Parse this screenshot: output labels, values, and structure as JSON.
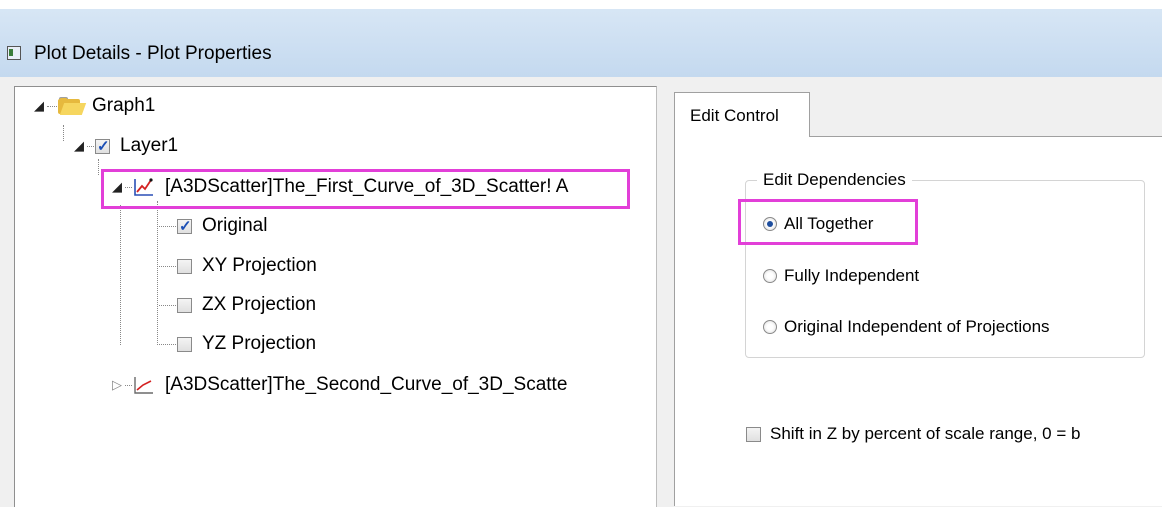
{
  "window": {
    "title": "Plot Details - Plot Properties"
  },
  "tree": {
    "graph": {
      "label": "Graph1"
    },
    "layer": {
      "label": "Layer1",
      "checked": true
    },
    "curve1": {
      "label": "[A3DScatter]The_First_Curve_of_3D_Scatter! A"
    },
    "children": [
      {
        "label": "Original",
        "checked": true
      },
      {
        "label": "XY Projection",
        "checked": false
      },
      {
        "label": "ZX Projection",
        "checked": false
      },
      {
        "label": "YZ Projection",
        "checked": false
      }
    ],
    "curve2": {
      "label": "[A3DScatter]The_Second_Curve_of_3D_Scatte"
    }
  },
  "tabs": {
    "edit_control": "Edit Control"
  },
  "edit_dependencies": {
    "title": "Edit Dependencies",
    "options": [
      "All Together",
      "Fully Independent",
      "Original Independent of Projections"
    ],
    "selected": "All Together"
  },
  "shift_z": {
    "label": "Shift in Z by percent of scale range, 0 = b",
    "checked": false
  },
  "colors": {
    "highlight": "#e23fd8",
    "titlebar": "#c4d9ef"
  }
}
